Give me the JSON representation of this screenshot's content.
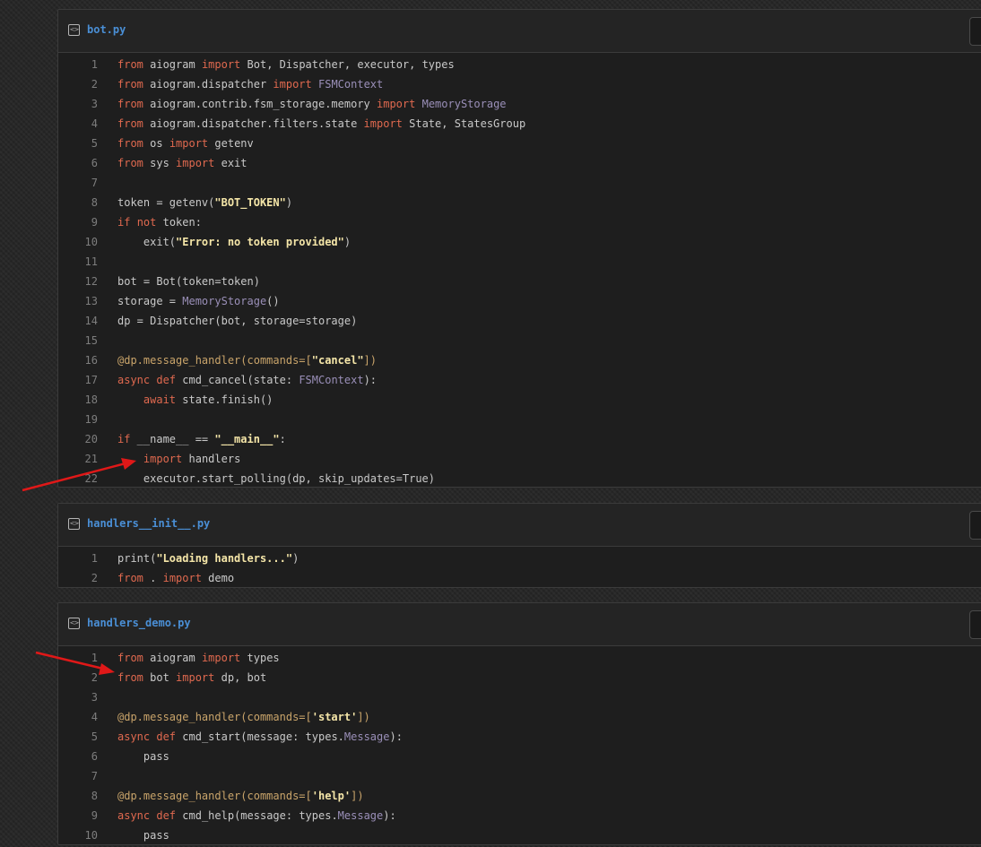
{
  "files": [
    {
      "name": "bot.py",
      "lines": [
        [
          [
            "k",
            "from"
          ],
          [
            "n",
            " aiogram "
          ],
          [
            "k",
            "import"
          ],
          [
            "n",
            " Bot, Dispatcher, executor, types"
          ]
        ],
        [
          [
            "k",
            "from"
          ],
          [
            "n",
            " aiogram.dispatcher "
          ],
          [
            "k",
            "import"
          ],
          [
            "n",
            " "
          ],
          [
            "t",
            "FSMContext"
          ]
        ],
        [
          [
            "k",
            "from"
          ],
          [
            "n",
            " aiogram.contrib.fsm_storage.memory "
          ],
          [
            "k",
            "import"
          ],
          [
            "n",
            " "
          ],
          [
            "t",
            "MemoryStorage"
          ]
        ],
        [
          [
            "k",
            "from"
          ],
          [
            "n",
            " aiogram.dispatcher.filters.state "
          ],
          [
            "k",
            "import"
          ],
          [
            "n",
            " State, StatesGroup"
          ]
        ],
        [
          [
            "k",
            "from"
          ],
          [
            "n",
            " os "
          ],
          [
            "k",
            "import"
          ],
          [
            "n",
            " getenv"
          ]
        ],
        [
          [
            "k",
            "from"
          ],
          [
            "n",
            " sys "
          ],
          [
            "k",
            "import"
          ],
          [
            "n",
            " exit"
          ]
        ],
        [],
        [
          [
            "n",
            "token = getenv("
          ],
          [
            "s",
            "\"BOT_TOKEN\""
          ],
          [
            "n",
            ")"
          ]
        ],
        [
          [
            "k",
            "if"
          ],
          [
            "n",
            " "
          ],
          [
            "k",
            "not"
          ],
          [
            "n",
            " token:"
          ]
        ],
        [
          [
            "n",
            "    exit("
          ],
          [
            "s",
            "\"Error: no token provided\""
          ],
          [
            "n",
            ")"
          ]
        ],
        [],
        [
          [
            "n",
            "bot = Bot(token=token)"
          ]
        ],
        [
          [
            "n",
            "storage = "
          ],
          [
            "t",
            "MemoryStorage"
          ],
          [
            "n",
            "()"
          ]
        ],
        [
          [
            "n",
            "dp = Dispatcher(bot, storage=storage)"
          ]
        ],
        [],
        [
          [
            "d",
            "@dp.message_handler(commands=["
          ],
          [
            "s",
            "\"cancel\""
          ],
          [
            "d",
            "])"
          ]
        ],
        [
          [
            "k",
            "async"
          ],
          [
            "n",
            " "
          ],
          [
            "k",
            "def"
          ],
          [
            "n",
            " cmd_cancel(state: "
          ],
          [
            "t",
            "FSMContext"
          ],
          [
            "n",
            "):"
          ]
        ],
        [
          [
            "n",
            "    "
          ],
          [
            "k",
            "await"
          ],
          [
            "n",
            " state.finish()"
          ]
        ],
        [],
        [
          [
            "k",
            "if"
          ],
          [
            "n",
            " __name__ == "
          ],
          [
            "s",
            "\"__main__\""
          ],
          [
            "n",
            ":"
          ]
        ],
        [
          [
            "n",
            "    "
          ],
          [
            "k",
            "import"
          ],
          [
            "n",
            " handlers"
          ]
        ],
        [
          [
            "n",
            "    executor.start_polling(dp, skip_updates=True)"
          ]
        ]
      ]
    },
    {
      "name": "handlers__init__.py",
      "lines": [
        [
          [
            "n",
            "print("
          ],
          [
            "s",
            "\"Loading handlers...\""
          ],
          [
            "n",
            ")"
          ]
        ],
        [
          [
            "k",
            "from"
          ],
          [
            "n",
            " . "
          ],
          [
            "k",
            "import"
          ],
          [
            "n",
            " demo"
          ]
        ]
      ]
    },
    {
      "name": "handlers_demo.py",
      "lines": [
        [
          [
            "k",
            "from"
          ],
          [
            "n",
            " aiogram "
          ],
          [
            "k",
            "import"
          ],
          [
            "n",
            " types"
          ]
        ],
        [
          [
            "k",
            "from"
          ],
          [
            "n",
            " bot "
          ],
          [
            "k",
            "import"
          ],
          [
            "n",
            " dp, bot"
          ]
        ],
        [],
        [
          [
            "d",
            "@dp.message_handler(commands=["
          ],
          [
            "s",
            "'start'"
          ],
          [
            "d",
            "])"
          ]
        ],
        [
          [
            "k",
            "async"
          ],
          [
            "n",
            " "
          ],
          [
            "k",
            "def"
          ],
          [
            "n",
            " cmd_start(message: types."
          ],
          [
            "t",
            "Message"
          ],
          [
            "n",
            "):"
          ]
        ],
        [
          [
            "n",
            "    pass"
          ]
        ],
        [],
        [
          [
            "d",
            "@dp.message_handler(commands=["
          ],
          [
            "s",
            "'help'"
          ],
          [
            "d",
            "])"
          ]
        ],
        [
          [
            "k",
            "async"
          ],
          [
            "n",
            " "
          ],
          [
            "k",
            "def"
          ],
          [
            "n",
            " cmd_help(message: types."
          ],
          [
            "t",
            "Message"
          ],
          [
            "n",
            "):"
          ]
        ],
        [
          [
            "n",
            "    pass"
          ]
        ]
      ]
    }
  ],
  "colors": {
    "keyword": "#e0694f",
    "string": "#f5e6a8",
    "decorator": "#c9a46a",
    "type": "#9a8fb8",
    "text": "#c9c9c9",
    "line_number": "#7d7d7d",
    "file_name": "#4a8fd6",
    "annotation_arrow": "#e01818"
  },
  "icons": [
    "code-file-icon",
    "copy-icon"
  ]
}
